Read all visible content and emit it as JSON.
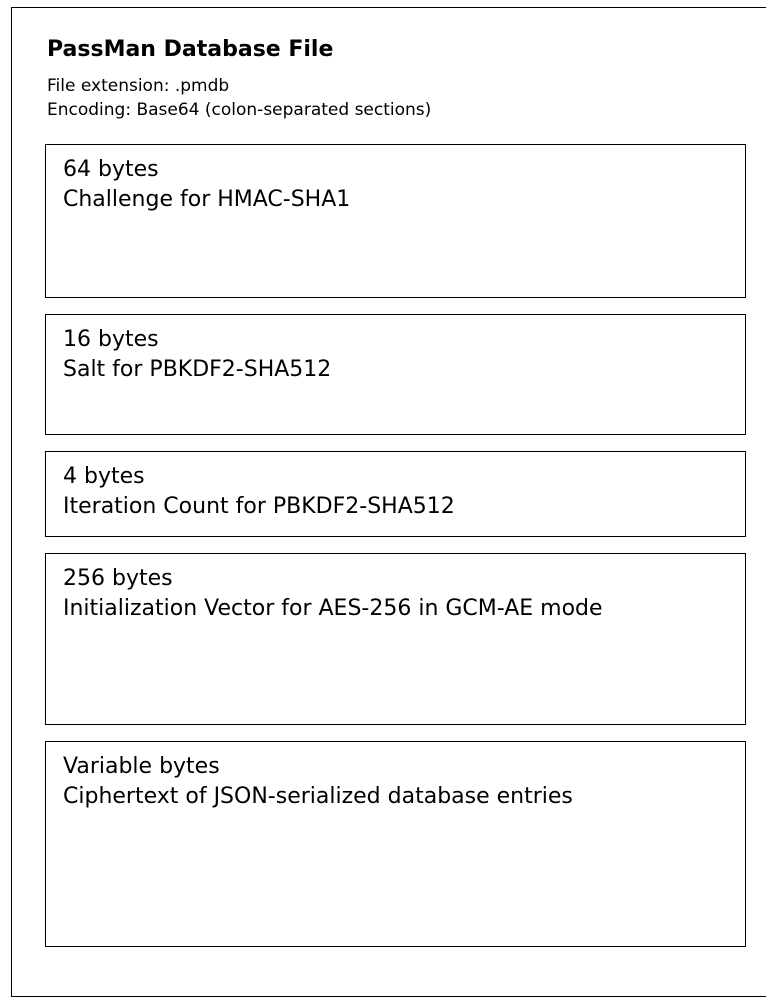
{
  "title": "PassMan Database File",
  "file_extension": "File extension: .pmdb",
  "encoding": "Encoding: Base64 (colon-separated sections)",
  "sections": [
    {
      "size": "64 bytes",
      "description": "Challenge for HMAC-SHA1"
    },
    {
      "size": "16 bytes",
      "description": "Salt for PBKDF2-SHA512"
    },
    {
      "size": "4 bytes",
      "description": "Iteration Count for PBKDF2-SHA512"
    },
    {
      "size": "256 bytes",
      "description": "Initialization Vector for AES-256 in GCM-AE mode"
    },
    {
      "size": "Variable bytes",
      "description": "Ciphertext of JSON-serialized database entries"
    }
  ]
}
